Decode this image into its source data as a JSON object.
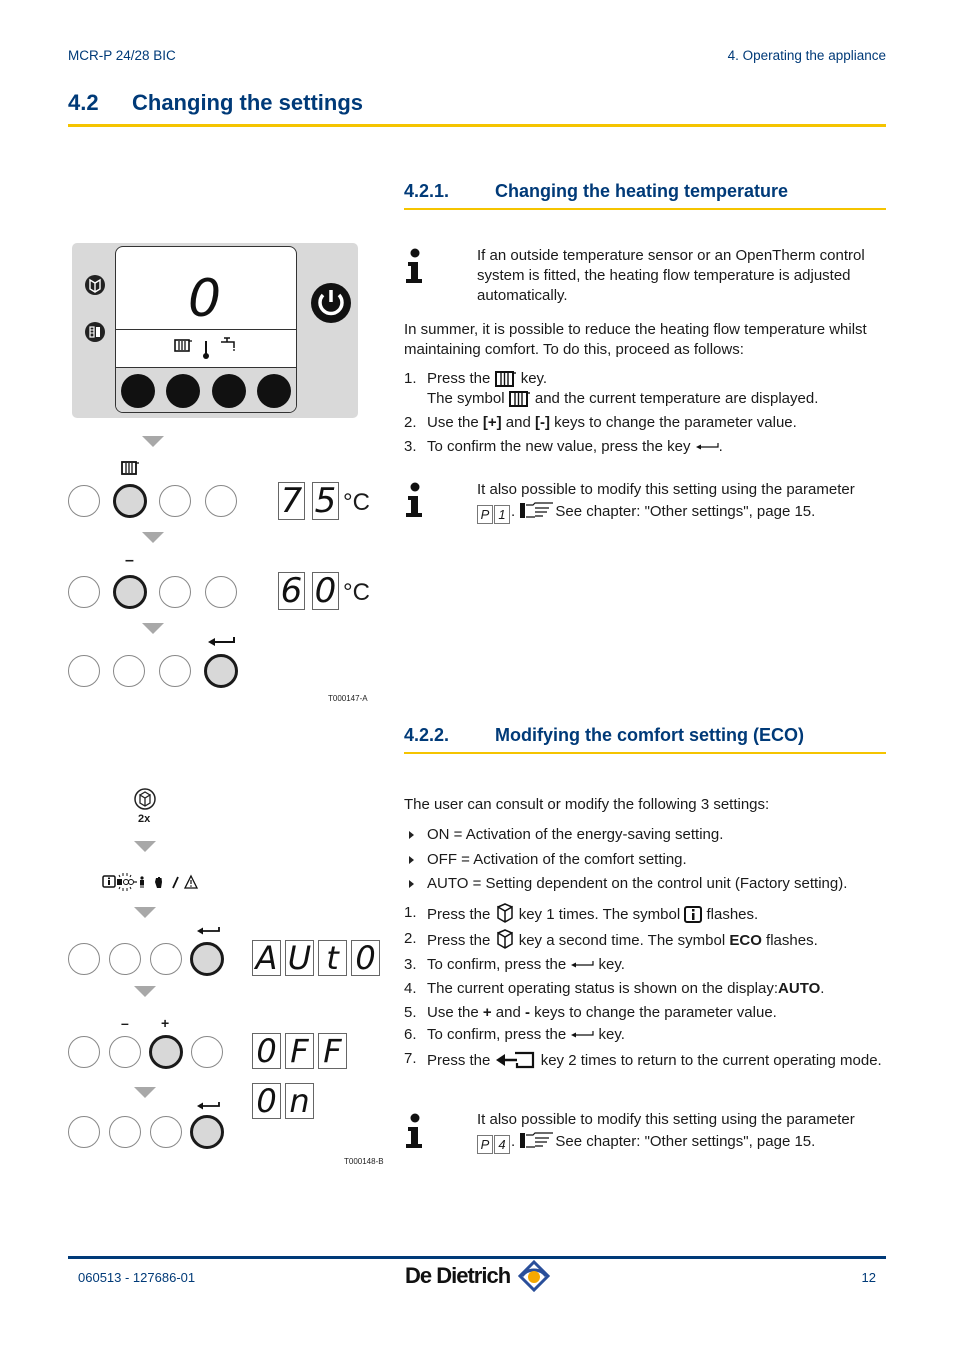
{
  "header": {
    "product": "MCR-P 24/28 BIC",
    "chapter": "4.  Operating the appliance"
  },
  "section": {
    "number": "4.2",
    "title": "Changing the settings"
  },
  "subsection1": {
    "number": "4.2.1.",
    "title": "Changing the heating temperature",
    "info_note": "If an outside temperature sensor or an OpenTherm control system is fitted, the heating flow temperature is adjusted automatically.",
    "intro": "In summer, it is possible to reduce the heating flow temperature whilst maintaining comfort. To do this, proceed as follows:",
    "steps": [
      {
        "n": "1.",
        "pre": "Press the ",
        "icon": "radiator-icon",
        "post": " key.",
        "line2_pre": "The symbol ",
        "line2_icon": "radiator-icon",
        "line2_post": " and the current temperature are displayed."
      },
      {
        "n": "2.",
        "pre": "Use the ",
        "b1": "[+]",
        "mid": " and ",
        "b2": "[-]",
        "post": " keys to change the parameter value."
      },
      {
        "n": "3.",
        "pre": "To confirm the new value, press the key ",
        "icon": "enter-arrow-icon",
        "post": "."
      }
    ],
    "param_note": {
      "pre": "It also possible to modify this setting using the parameter",
      "param_chars": [
        "P",
        "1"
      ],
      "ref": "See chapter:  \"Other settings\", page 15."
    },
    "figure": {
      "panel_display_digit": "0",
      "step1_display": [
        "7",
        "5"
      ],
      "step2_display": [
        "6",
        "0"
      ],
      "unit": "°C",
      "minus_label": "–",
      "code": "T000147-A"
    }
  },
  "subsection2": {
    "number": "4.2.2.",
    "title": "Modifying the comfort setting (ECO)",
    "intro": "The user can consult or modify the following 3 settings:",
    "bullets": [
      "ON = Activation of the energy-saving setting.",
      "OFF = Activation of the comfort setting.",
      "AUTO = Setting dependent on the control unit (Factory setting)."
    ],
    "steps": [
      {
        "n": "1.",
        "pre": "Press the ",
        "icon": "eco-key-icon",
        "post": " key 1 times. The symbol ",
        "icon2": "info-box-icon",
        "post2": " flashes."
      },
      {
        "n": "2.",
        "pre": "Press the ",
        "icon": "eco-key-icon",
        "post": " key a second time. The symbol ",
        "bold": "ECO",
        "post2": " flashes."
      },
      {
        "n": "3.",
        "pre": "To confirm, press the ",
        "icon": "enter-arrow-icon",
        "post": " key."
      },
      {
        "n": "4.",
        "pre": "The current operating status is shown on the display:",
        "bold": "AUTO",
        "post": "."
      },
      {
        "n": "5.",
        "pre": "Use the ",
        "b1": "+",
        "mid": " and ",
        "b2": "-",
        "post": " keys to change the parameter value."
      },
      {
        "n": "6.",
        "pre": "To confirm, press the ",
        "icon": "enter-arrow-icon",
        "post": " key."
      },
      {
        "n": "7.",
        "pre": "Press the ",
        "icon": "return-key-icon",
        "post": " key 2 times to return to the current operating mode."
      }
    ],
    "param_note": {
      "pre": "It also possible to modify this setting using the parameter",
      "param_chars": [
        "P",
        "4"
      ],
      "ref": "See chapter:  \"Other settings\", page 15."
    },
    "figure": {
      "press_count": "2x",
      "auto_display": [
        "A",
        "U",
        "t",
        "0"
      ],
      "off_display": [
        "0",
        "F",
        "F"
      ],
      "on_display": [
        "0",
        "n"
      ],
      "minus_label": "–",
      "plus_label": "+",
      "code": "T000148-B"
    }
  },
  "footer": {
    "doc_code": "060513 - 127686-01",
    "brand": "De Dietrich",
    "page": "12"
  },
  "colors": {
    "heading_blue": "#003a78",
    "rule_yellow": "#f5c400",
    "brand_orange": "#f5a800"
  }
}
